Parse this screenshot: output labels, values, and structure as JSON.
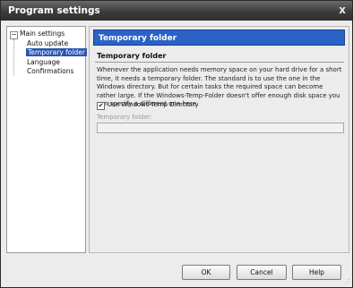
{
  "window": {
    "title": "Program settings",
    "close_glyph": "x"
  },
  "tree": {
    "root_label": "Main settings",
    "expander_glyph": "−",
    "items": [
      {
        "label": "Auto update",
        "selected": false
      },
      {
        "label": "Temporary folder",
        "selected": true
      },
      {
        "label": "Language",
        "selected": false
      },
      {
        "label": "Confirmations",
        "selected": false
      }
    ]
  },
  "panel": {
    "banner_title": "Temporary folder",
    "section_title": "Temporary folder",
    "description": "Whenever the application needs memory space on your hard drive for a short time, it needs a temporary folder. The standard is to use the one in the Windows directory. But for certain tasks the required space can become rather large. If the Windows-Temp-Folder doesn't offer enough disk space you can specify a different one here.",
    "use_windows_temp": {
      "label": "Use Windows-Temp Directory",
      "checked": true,
      "check_glyph": "✔"
    },
    "temp_folder": {
      "label": "Temporary folder:",
      "value": "",
      "placeholder": "",
      "enabled": false,
      "browse_icon": "folder-icon"
    }
  },
  "buttons": {
    "ok": "OK",
    "cancel": "Cancel",
    "help": "Help"
  },
  "colors": {
    "banner": "#2b62c6",
    "selection": "#2a56b0",
    "titlebar": "#3c3c3c"
  }
}
